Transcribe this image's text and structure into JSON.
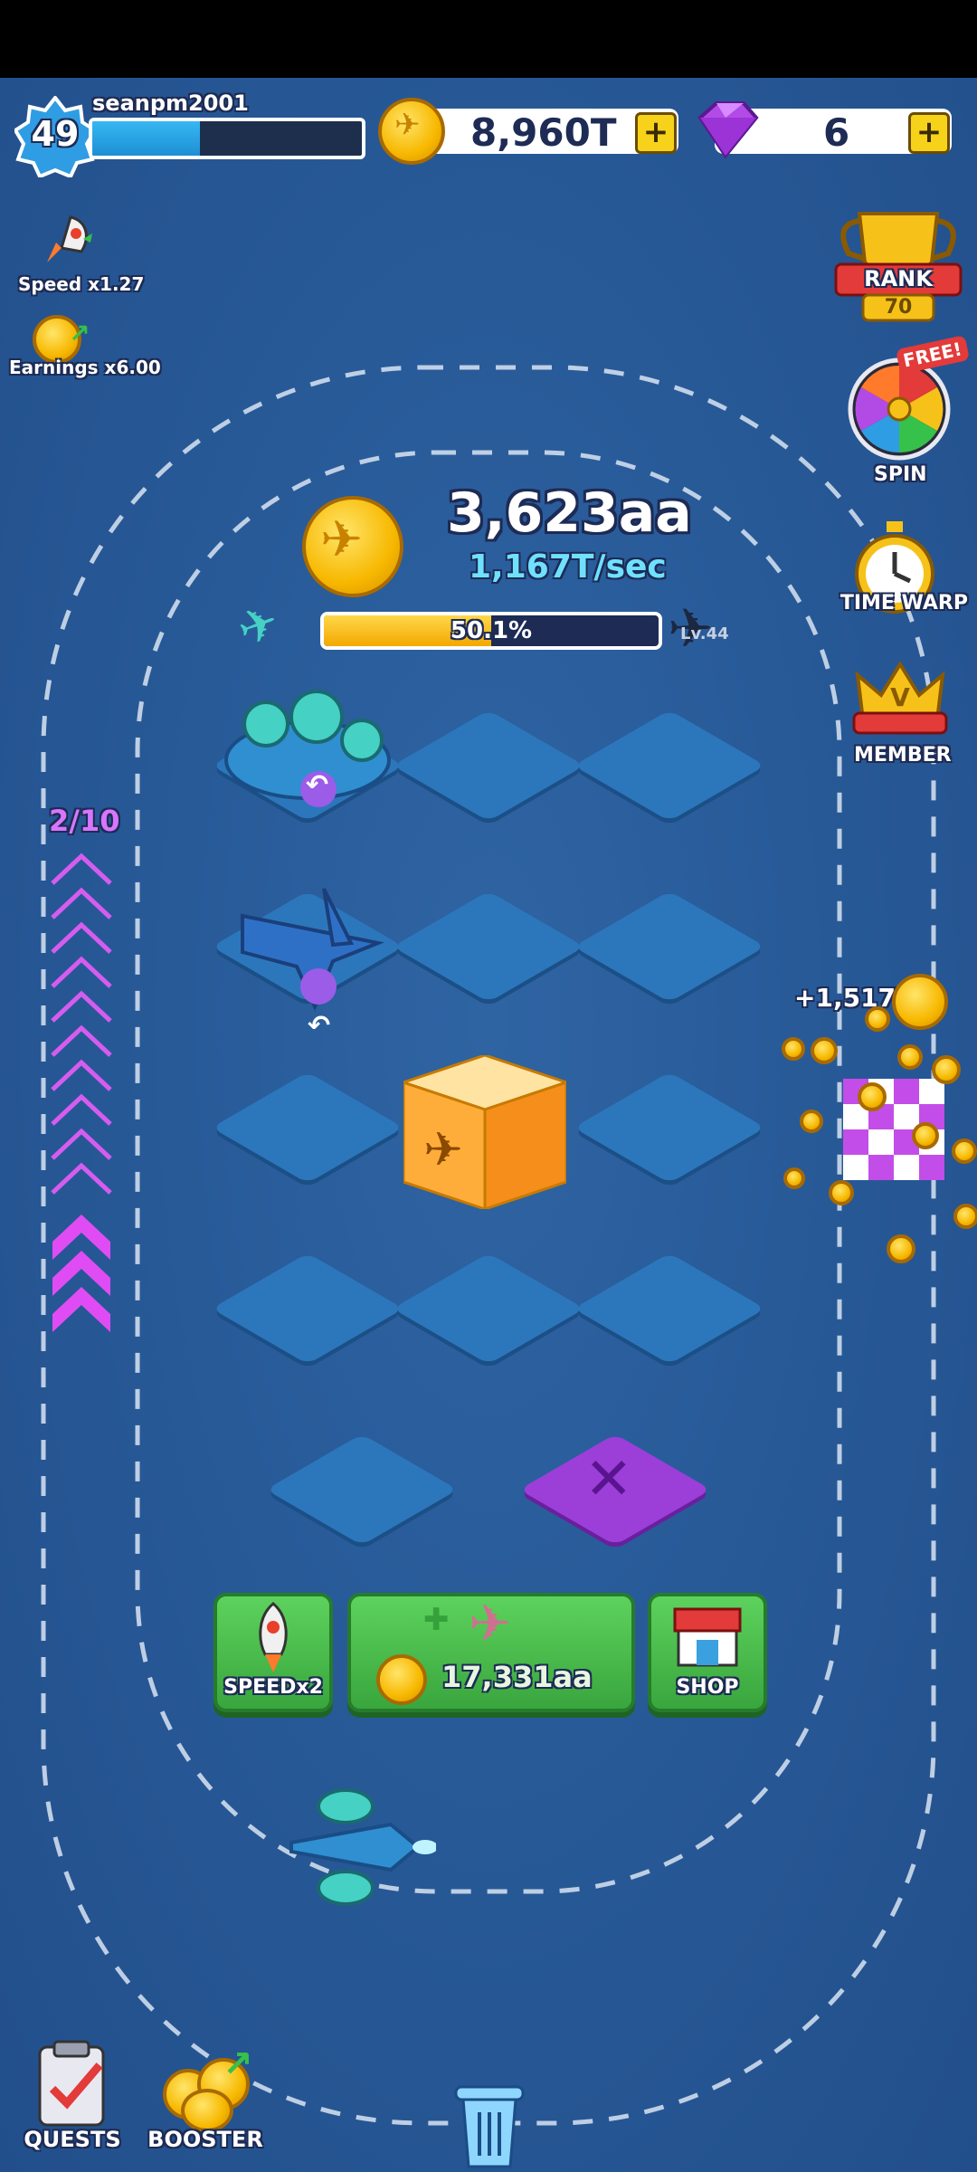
{
  "player": {
    "level": "49",
    "username": "seanpm2001",
    "xp_fraction": 0.4
  },
  "currency": {
    "coins": "8,960T",
    "gems": "6"
  },
  "boosts": {
    "speed_label": "Speed x1.27",
    "earnings_label": "Earnings x6.00"
  },
  "side_menu": {
    "rank_label": "RANK",
    "rank_value": "70",
    "spin_badge": "FREE!",
    "spin_label": "SPIN",
    "timewarp_label": "TIME WARP",
    "member_label": "MEMBER"
  },
  "earnings": {
    "total": "3,623aa",
    "rate": "1,167T/sec",
    "progress_label": "50.1%",
    "progress_fraction": 0.501,
    "next_level": "Lv.44"
  },
  "merge_grid": {
    "counter": "2/10"
  },
  "race": {
    "bonus": "+1,517T"
  },
  "actions": {
    "speed_label": "SPEEDx2",
    "buy_price": "17,331aa",
    "shop_label": "SHOP"
  },
  "bottom_nav": {
    "quests_label": "QUESTS",
    "booster_label": "BOOSTER"
  },
  "colors": {
    "background": "#285a98",
    "tile": "#2c77bb",
    "accent_purple": "#c34de8",
    "coin_gold": "#f7b800",
    "button_green": "#45b549"
  },
  "icons": [
    "level-badge-icon",
    "coin-icon",
    "gem-icon",
    "plus-icon",
    "rocket-icon",
    "rank-trophy-icon",
    "spin-wheel-icon",
    "stopwatch-icon",
    "member-crown-icon",
    "crate-icon",
    "close-icon",
    "shop-icon",
    "quests-icon",
    "booster-icon",
    "trash-icon"
  ]
}
